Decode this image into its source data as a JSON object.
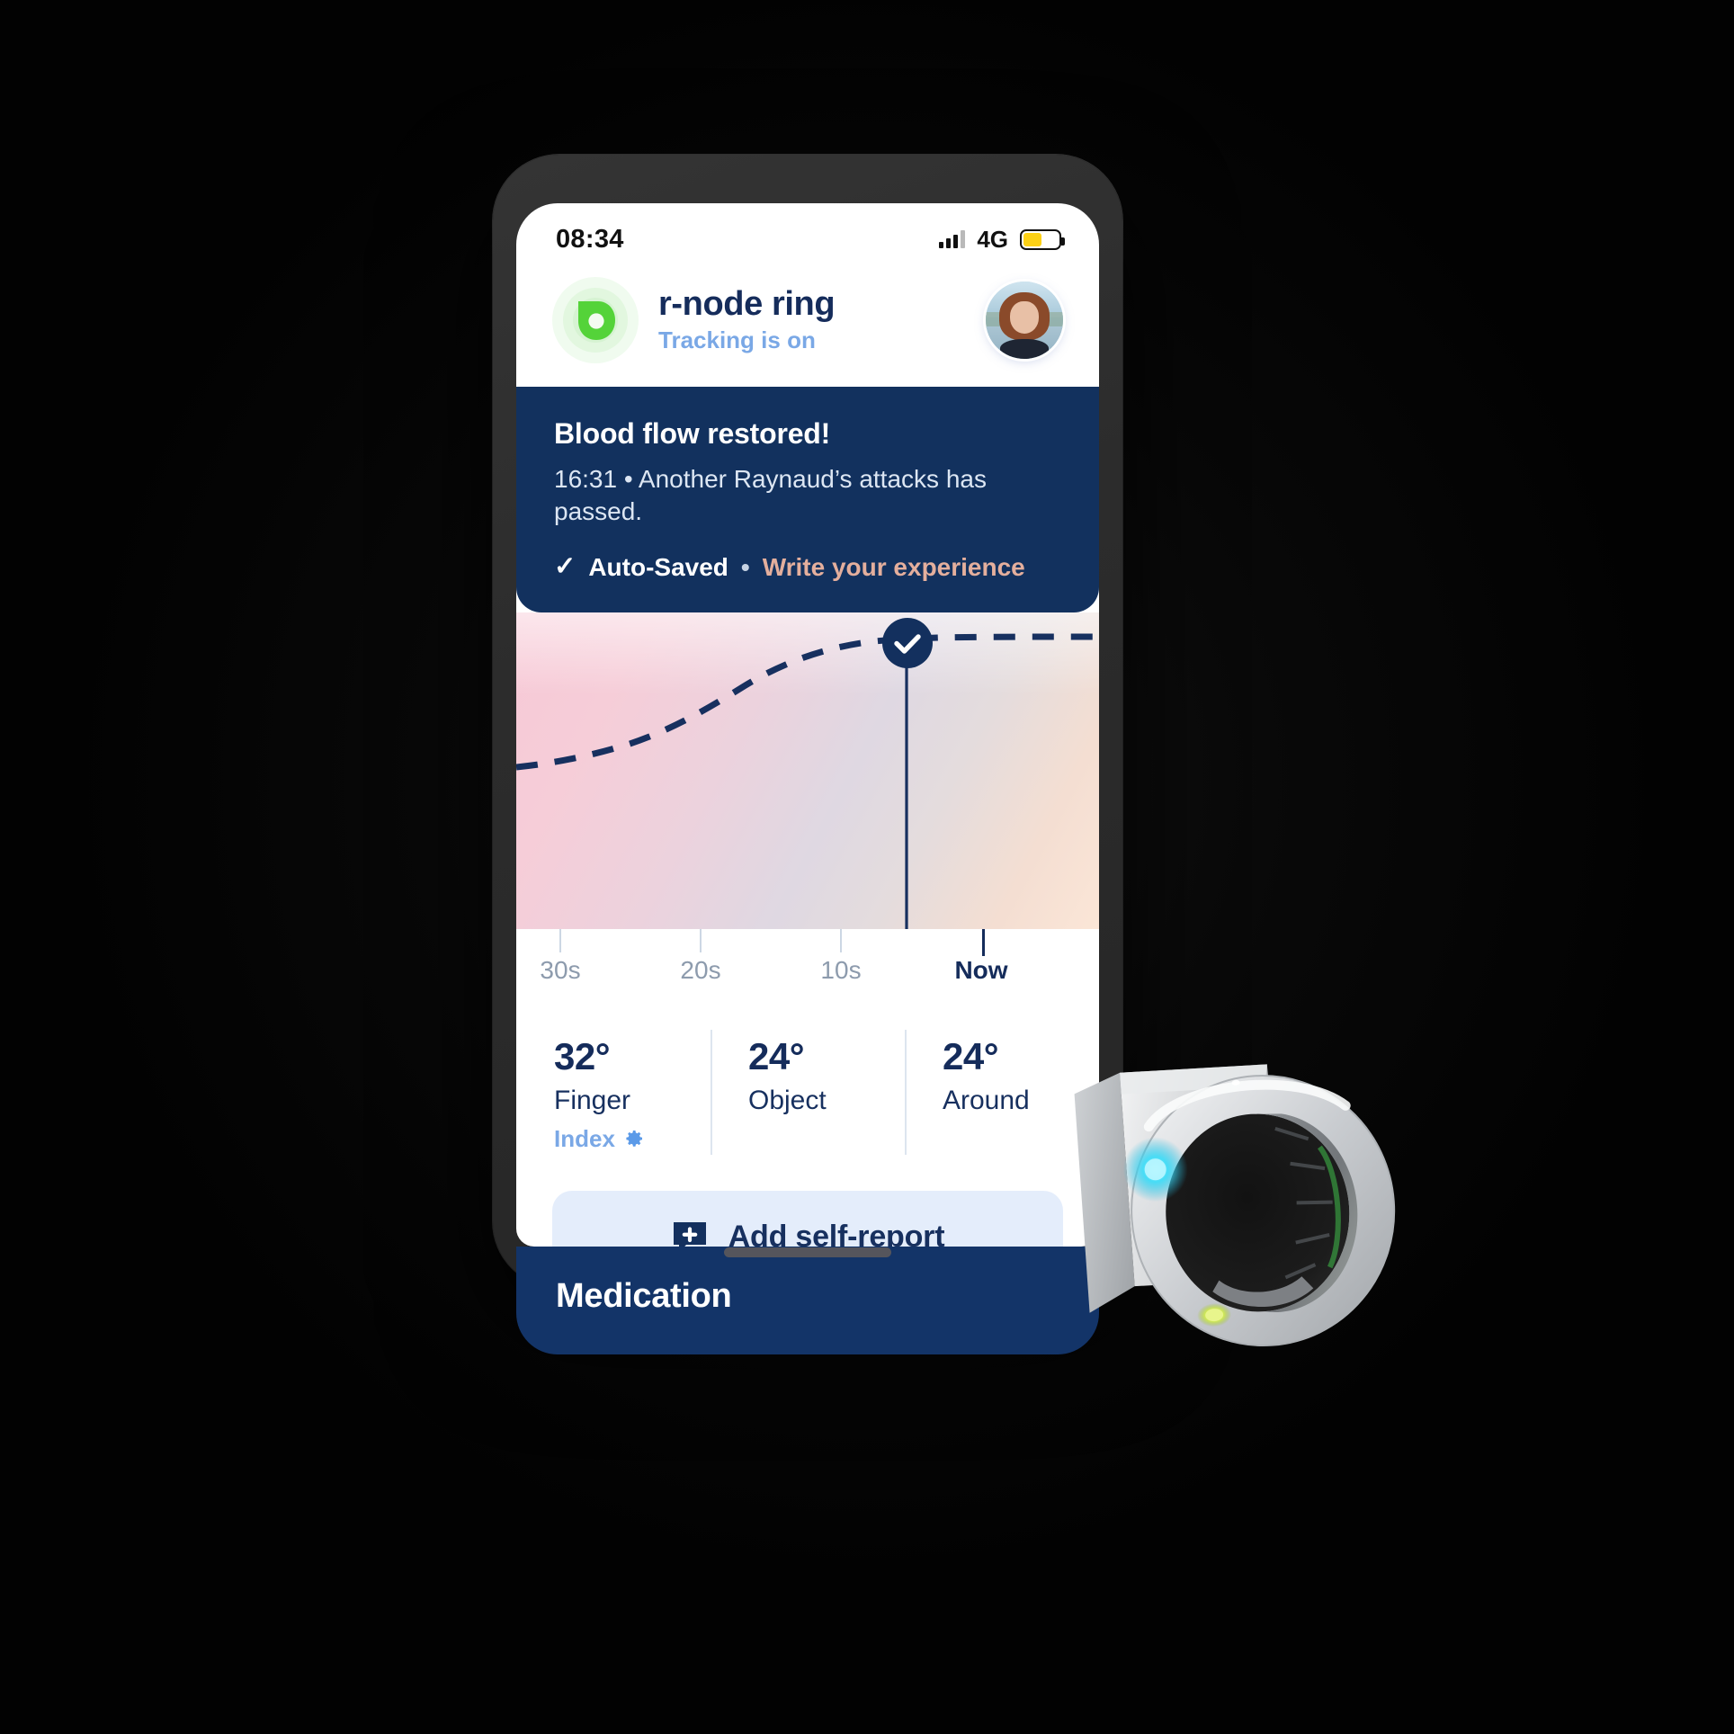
{
  "statusbar": {
    "time": "08:34",
    "network": "4G",
    "signal_icon": "signal-bars-icon",
    "battery_icon": "battery-icon",
    "battery_level": 52
  },
  "header": {
    "logo_icon": "r-node-droplet-logo-icon",
    "title": "r-node ring",
    "subtitle": "Tracking is on",
    "avatar_icon": "user-avatar"
  },
  "notification": {
    "title": "Blood flow restored!",
    "time": "16:31",
    "separator": "•",
    "message": "Another Raynaud’s attacks has passed.",
    "check_icon": "check-icon",
    "saved_label": "Auto-Saved",
    "action_link": "Write your experience"
  },
  "chart_data": {
    "type": "line",
    "title": "",
    "xlabel": "",
    "ylabel": "",
    "x_tick_labels": [
      "30s",
      "20s",
      "10s",
      "Now"
    ],
    "x_tick_positions_pct": [
      7.5,
      31.5,
      55.5,
      80.0
    ],
    "marker": {
      "icon": "check-marker-icon",
      "label": "Now",
      "x_pct": 67.0,
      "y_pct": 9.0
    },
    "line_style": "dashed",
    "line_color": "#17305f",
    "fill_gradient": [
      "#f7c9d6",
      "#dfd8e2",
      "#fbe6d7"
    ],
    "x": [
      0,
      10,
      20,
      30,
      40,
      50,
      60,
      67,
      75,
      85,
      100
    ],
    "y": [
      49,
      47,
      44,
      39,
      30,
      21,
      14,
      11,
      9,
      8,
      8
    ],
    "grid": false,
    "legend": "none"
  },
  "metrics": [
    {
      "value": "32°",
      "label": "Finger",
      "extra": "Index",
      "extra_icon": "gear-icon"
    },
    {
      "value": "24°",
      "label": "Object",
      "extra": "",
      "extra_icon": ""
    },
    {
      "value": "24°",
      "label": "Around",
      "extra": "",
      "extra_icon": ""
    }
  ],
  "self_report": {
    "icon": "add-comment-icon",
    "label": "Add self-report"
  },
  "medication": {
    "title": "Medication"
  },
  "device": {
    "home_indicator": "home-indicator"
  },
  "product": {
    "ring_image": "r-node-smart-ring-render",
    "led_color": "#35d8f5",
    "sensor_color": "#d4e85a"
  },
  "colors": {
    "navy": "#152c5b",
    "navy_panel": "#12315e",
    "accent_blue": "#7aa8e6",
    "accent_peach": "#e4af9d",
    "logo_green": "#54d339",
    "battery_yellow": "#fcd116"
  }
}
